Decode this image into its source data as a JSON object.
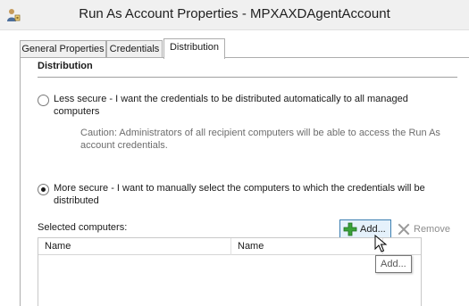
{
  "window": {
    "title": "Run As Account Properties - MPXAXDAgentAccount",
    "icon": "run-as-account-icon"
  },
  "tabs": [
    {
      "label": "General Properties",
      "active": false
    },
    {
      "label": "Credentials",
      "active": false
    },
    {
      "label": "Distribution",
      "active": true
    }
  ],
  "distribution": {
    "heading": "Distribution",
    "less_secure": {
      "label": "Less secure - I want the credentials to be distributed automatically to all managed computers",
      "caution": "Caution: Administrators of all recipient computers will be able to access the Run As account credentials.",
      "checked": false
    },
    "more_secure": {
      "label": "More secure - I want to manually select the computers to which the credentials will be distributed",
      "checked": true
    },
    "selected_computers_label": "Selected computers:",
    "add_button": {
      "label": "Add...",
      "icon": "green-plus-icon"
    },
    "remove_button": {
      "label": "Remove",
      "icon": "gray-x-icon",
      "enabled": false
    },
    "columns": [
      "Name",
      "Name"
    ],
    "tooltip": "Add..."
  },
  "colors": {
    "add_button_border": "#3c7fb1",
    "add_button_bg": "#e5f1fb",
    "plus_green": "#3aa23a",
    "disabled_text": "#8d8d8d"
  }
}
